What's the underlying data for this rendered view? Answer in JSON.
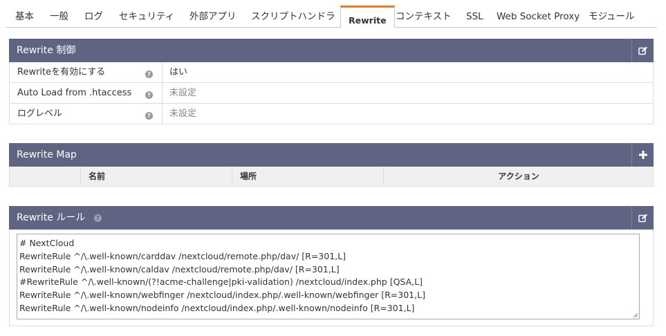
{
  "tabs": [
    {
      "label": "基本"
    },
    {
      "label": "一般"
    },
    {
      "label": "ログ"
    },
    {
      "label": "セキュリティ"
    },
    {
      "label": "外部アプリ"
    },
    {
      "label": "スクリプトハンドラ"
    },
    {
      "label": "Rewrite",
      "active": true
    },
    {
      "label": "コンテキスト"
    },
    {
      "label": "SSL"
    },
    {
      "label": "Web Socket Proxy"
    },
    {
      "label": "モジュール"
    }
  ],
  "rewrite_control": {
    "title": "Rewrite 制御",
    "edit_icon": "edit-icon",
    "rows": [
      {
        "label": "Rewriteを有効にする",
        "value": "はい",
        "value_set": true
      },
      {
        "label": "Auto Load from .htaccess",
        "value": "未設定",
        "value_set": false
      },
      {
        "label": "ログレベル",
        "value": "未設定",
        "value_set": false
      }
    ]
  },
  "rewrite_map": {
    "title": "Rewrite Map",
    "add_icon": "plus-icon",
    "columns": [
      "名前",
      "場所",
      "アクション"
    ]
  },
  "rewrite_rules": {
    "title": "Rewrite ルール",
    "edit_icon": "edit-icon",
    "lines": [
      "# NextCloud",
      "RewriteRule ^/\\.well-known/carddav /nextcloud/remote.php/dav/ [R=301,L]",
      "RewriteRule ^/\\.well-known/caldav /nextcloud/remote.php/dav/ [R=301,L]",
      "#RewriteRule ^/\\.well-known/(?!acme-challenge|pki-validation) /nextcloud/index.php [QSA,L]",
      "RewriteRule ^/\\.well-known/webfinger /nextcloud/index.php/.well-known/webfinger [R=301,L]",
      "RewriteRule ^/\\.well-known/nodeinfo /nextcloud/index.php/.well-known/nodeinfo [R=301,L]"
    ]
  },
  "colors": {
    "panel_header": "#5f6482",
    "active_tab_accent": "#e07a2a"
  }
}
